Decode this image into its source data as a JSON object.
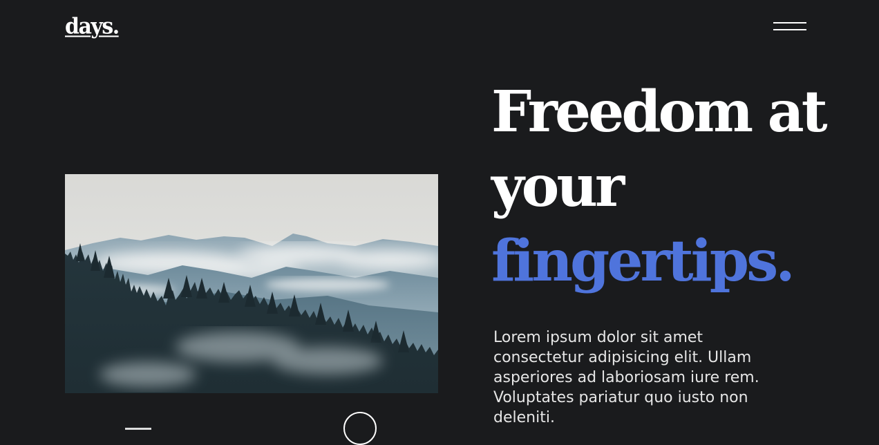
{
  "brand": {
    "logo_text": "days."
  },
  "header": {
    "menu_icon": "hamburger-menu-icon"
  },
  "hero": {
    "headline_line1": "Freedom at",
    "headline_line2": "your",
    "headline_line3": "fingertips.",
    "description": "Lorem ipsum dolor sit amet consectetur adipisicing elit. Ullam asperiores ad laboriosam iure rem. Voluptates pariatur quo iusto non deleniti.",
    "image_subject": "misty mountains with pine forest"
  },
  "colors": {
    "background": "#1a1b1d",
    "text": "#ffffff",
    "accent": "#4f74dc"
  }
}
